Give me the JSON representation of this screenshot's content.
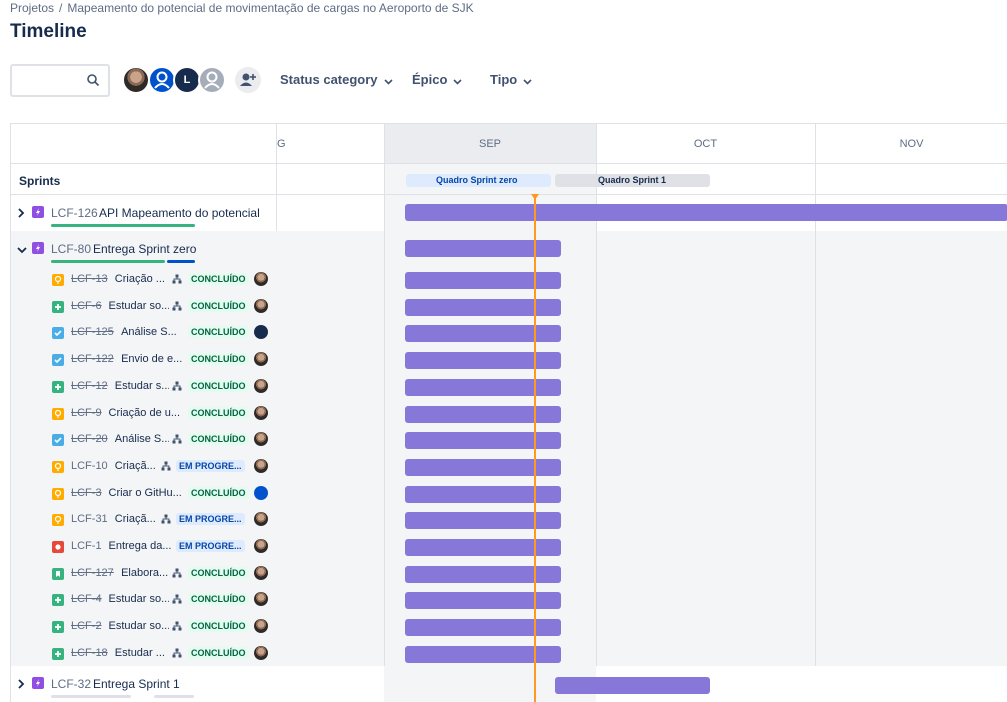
{
  "breadcrumb": {
    "root": "Projetos",
    "separator": "/",
    "project": "Mapeamento do potencial de movimentação de cargas no Aeroporto de SJK"
  },
  "page": {
    "title": "Timeline"
  },
  "search": {
    "value": "",
    "placeholder": ""
  },
  "avatars": [
    {
      "name": "user-photo-avatar",
      "style": "photo"
    },
    {
      "name": "user-generic-avatar",
      "style": "blue"
    },
    {
      "name": "user-l-avatar",
      "style": "dark",
      "initial": "L"
    },
    {
      "name": "user-grey-avatar",
      "style": "grey"
    }
  ],
  "filters": {
    "status_category": "Status category",
    "epic": "Épico",
    "type": "Tipo"
  },
  "timeline": {
    "months": [
      {
        "label": "G"
      },
      {
        "label": "SEP"
      },
      {
        "label": "OCT"
      },
      {
        "label": "NOV"
      }
    ],
    "sprints_label": "Sprints",
    "sprints": [
      {
        "label": "Quadro Sprint zero"
      },
      {
        "label": "Quadro Sprint 1"
      }
    ]
  },
  "colors": {
    "epic": "#904ee2",
    "story": "#6554c0",
    "task": "#4bade8",
    "subtask": "#4bade8",
    "idea": "#ffab00",
    "improvement": "#36b37e",
    "bug": "#e5493a",
    "bookmark": "#36b37e",
    "bar": "#8777d9",
    "today": "#ff991f"
  },
  "epics": {
    "e126": {
      "key": "LCF-126",
      "summary": "API Mapeamento do potencial"
    },
    "e80": {
      "key": "LCF-80",
      "summary": "Entrega Sprint zero"
    },
    "e32": {
      "key": "LCF-32",
      "summary": "Entrega Sprint 1"
    }
  },
  "issues": [
    {
      "key": "LCF-13",
      "summary": "Criação ...",
      "status": "CONCLUÍDO",
      "type": "idea",
      "done": true,
      "child": true,
      "assignee": "photo"
    },
    {
      "key": "LCF-6",
      "summary": "Estudar so...",
      "status": "CONCLUÍDO",
      "type": "improvement",
      "done": true,
      "child": true,
      "assignee": "photo"
    },
    {
      "key": "LCF-125",
      "summary": "Análise S...",
      "status": "CONCLUÍDO",
      "type": "task",
      "done": true,
      "child": false,
      "assignee": "dark"
    },
    {
      "key": "LCF-122",
      "summary": "Envio de e...",
      "status": "CONCLUÍDO",
      "type": "task",
      "done": true,
      "child": false,
      "assignee": "photo"
    },
    {
      "key": "LCF-12",
      "summary": "Estudar s...",
      "status": "CONCLUÍDO",
      "type": "improvement",
      "done": true,
      "child": true,
      "assignee": "photo"
    },
    {
      "key": "LCF-9",
      "summary": "Criação de u...",
      "status": "CONCLUÍDO",
      "type": "idea",
      "done": true,
      "child": false,
      "assignee": "photo"
    },
    {
      "key": "LCF-20",
      "summary": "Análise S...",
      "status": "CONCLUÍDO",
      "type": "task",
      "done": true,
      "child": true,
      "assignee": "photo"
    },
    {
      "key": "LCF-10",
      "summary": "Criaçã...",
      "status": "EM PROGRE...",
      "type": "idea",
      "done": false,
      "child": true,
      "assignee": "photo"
    },
    {
      "key": "LCF-3",
      "summary": "Criar o GitHu...",
      "status": "CONCLUÍDO",
      "type": "idea",
      "done": true,
      "child": false,
      "assignee": "blue"
    },
    {
      "key": "LCF-31",
      "summary": "Criaçã...",
      "status": "EM PROGRE...",
      "type": "idea",
      "done": false,
      "child": true,
      "assignee": "photo"
    },
    {
      "key": "LCF-1",
      "summary": "Entrega da...",
      "status": "EM PROGRE...",
      "type": "bug",
      "done": false,
      "child": false,
      "assignee": "photo"
    },
    {
      "key": "LCF-127",
      "summary": "Elabora...",
      "status": "CONCLUÍDO",
      "type": "bookmark",
      "done": true,
      "child": true,
      "assignee": "photo"
    },
    {
      "key": "LCF-4",
      "summary": "Estudar so...",
      "status": "CONCLUÍDO",
      "type": "improvement",
      "done": true,
      "child": true,
      "assignee": "photo"
    },
    {
      "key": "LCF-2",
      "summary": "Estudar so...",
      "status": "CONCLUÍDO",
      "type": "improvement",
      "done": true,
      "child": true,
      "assignee": "photo"
    },
    {
      "key": "LCF-18",
      "summary": "Estudar ...",
      "status": "CONCLUÍDO",
      "type": "improvement",
      "done": true,
      "child": true,
      "assignee": "photo"
    }
  ]
}
